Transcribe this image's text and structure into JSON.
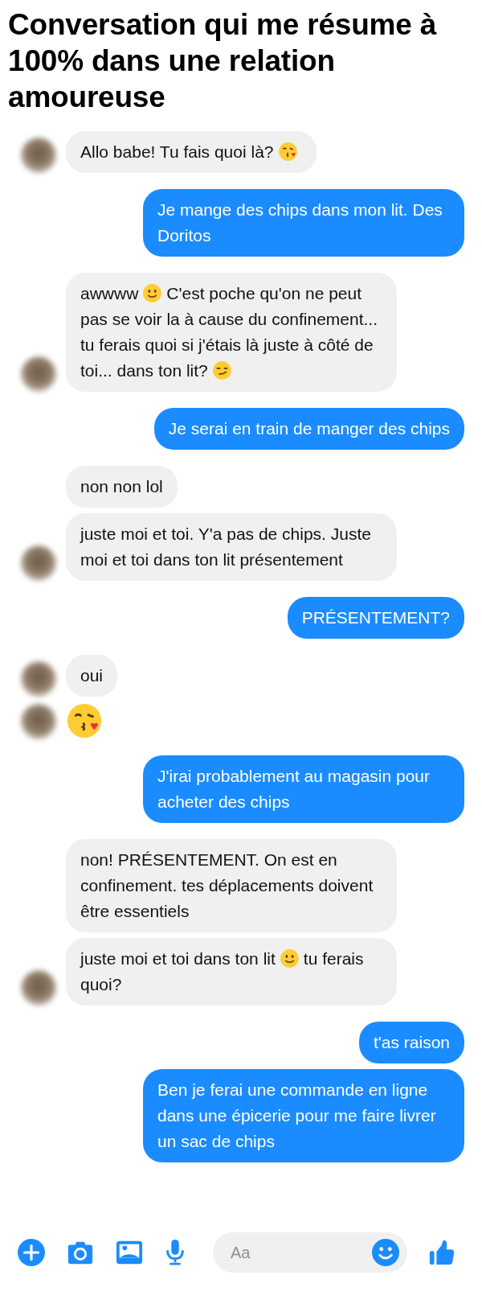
{
  "title": "Conversation qui me résume à 100% dans une relation amoureuse",
  "messages": [
    {
      "outgoing": false,
      "avatar": true,
      "segments": [
        {
          "kind": "text",
          "text": "Allo babe! Tu fais quoi là?"
        },
        {
          "kind": "kiss"
        }
      ]
    },
    {
      "outgoing": true,
      "segments": [
        {
          "kind": "text",
          "text": "Je mange des chips dans mon lit. Des Doritos"
        }
      ]
    },
    {
      "outgoing": false,
      "avatar": true,
      "segments": [
        {
          "kind": "text",
          "text": "awwww"
        },
        {
          "kind": "smile"
        },
        {
          "kind": "text",
          "text": "C'est poche qu'on ne peut pas se voir la à cause du confinement... tu ferais quoi si j'étais là juste à côté de toi... dans ton lit?"
        },
        {
          "kind": "smirk"
        }
      ]
    },
    {
      "outgoing": true,
      "segments": [
        {
          "kind": "text",
          "text": "Je serai en train de manger des chips"
        }
      ]
    },
    {
      "outgoing": false,
      "avatar": false,
      "segments": [
        {
          "kind": "text",
          "text": "non non lol"
        }
      ]
    },
    {
      "outgoing": false,
      "avatar": true,
      "segments": [
        {
          "kind": "text",
          "text": "juste moi et toi. Y'a pas de chips. Juste moi et toi dans ton lit présentement"
        }
      ]
    },
    {
      "outgoing": true,
      "segments": [
        {
          "kind": "text",
          "text": "PRÉSENTEMENT?"
        }
      ]
    },
    {
      "outgoing": false,
      "avatar": true,
      "segments": [
        {
          "kind": "text",
          "text": "oui"
        }
      ]
    },
    {
      "outgoing": false,
      "avatar": true,
      "segments": [
        {
          "kind": "bigkiss"
        }
      ]
    },
    {
      "outgoing": true,
      "segments": [
        {
          "kind": "text",
          "text": "J'irai probablement au magasin pour acheter des chips"
        }
      ]
    },
    {
      "outgoing": false,
      "avatar": false,
      "segments": [
        {
          "kind": "text",
          "text": "non! PRÉSENTEMENT. On est en confinement. tes déplacements doivent être essentiels"
        }
      ]
    },
    {
      "outgoing": false,
      "avatar": true,
      "segments": [
        {
          "kind": "text",
          "text": "juste moi et toi dans ton lit"
        },
        {
          "kind": "smile"
        },
        {
          "kind": "text",
          "text": "tu ferais quoi?"
        }
      ]
    },
    {
      "outgoing": true,
      "segments": [
        {
          "kind": "text",
          "text": "t'as raison"
        }
      ]
    },
    {
      "outgoing": true,
      "segments": [
        {
          "kind": "text",
          "text": "Ben je ferai une commande en ligne dans une épicerie pour me faire livrer un sac de chips"
        }
      ]
    }
  ],
  "composer": {
    "placeholder": "Aa"
  }
}
